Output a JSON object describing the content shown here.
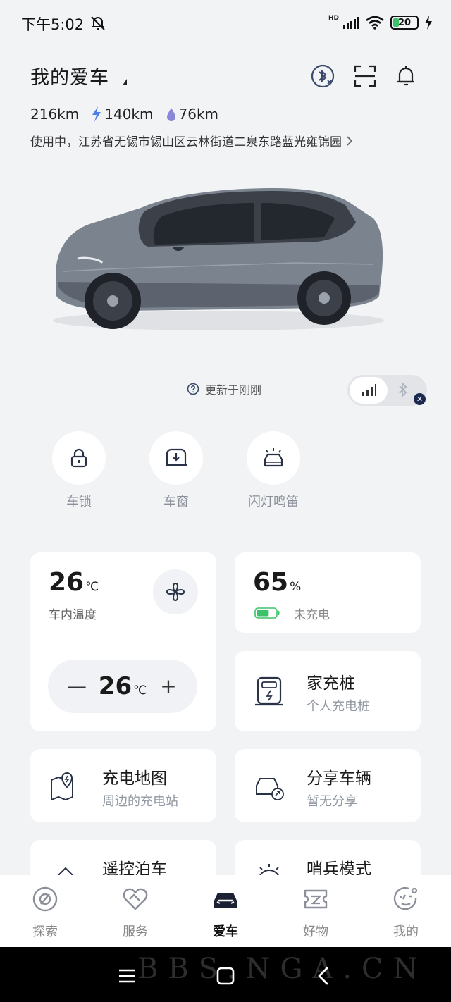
{
  "status_bar": {
    "time": "下午5:02",
    "network": "HD",
    "battery": "20"
  },
  "header": {
    "title": "我的爱车"
  },
  "stats": {
    "total_range": "216km",
    "electric_range": "140km",
    "fuel_range": "76km"
  },
  "location": "使用中，江苏省无锡市锡山区云林街道二泉东路蓝光雍锦园",
  "update_text": "更新于刚刚",
  "quick_actions": [
    {
      "label": "车锁",
      "icon": "lock-icon"
    },
    {
      "label": "车窗",
      "icon": "window-icon"
    },
    {
      "label": "闪灯鸣笛",
      "icon": "flash-horn-icon"
    }
  ],
  "climate": {
    "temp": "26",
    "unit": "℃",
    "label": "车内温度",
    "set_temp": "26",
    "set_unit": "℃",
    "minus": "—",
    "plus": "+"
  },
  "battery_card": {
    "percent": "65",
    "unit": "%",
    "status": "未充电",
    "level": 0.65,
    "color": "#3dc26a"
  },
  "cards": {
    "home_charger": {
      "title": "家充桩",
      "subtitle": "个人充电桩"
    },
    "charge_map": {
      "title": "充电地图",
      "subtitle": "周边的充电站"
    },
    "share_car": {
      "title": "分享车辆",
      "subtitle": "暂无分享"
    },
    "remote_park": {
      "title": "遥控泊车"
    },
    "sentry_mode": {
      "title": "哨兵模式"
    }
  },
  "bottom_nav": [
    {
      "label": "探索",
      "icon": "explore-icon"
    },
    {
      "label": "服务",
      "icon": "service-icon"
    },
    {
      "label": "爱车",
      "icon": "car-icon",
      "active": true
    },
    {
      "label": "好物",
      "icon": "shop-icon"
    },
    {
      "label": "我的",
      "icon": "profile-icon"
    }
  ],
  "watermark": "BBS.NGA.CN"
}
